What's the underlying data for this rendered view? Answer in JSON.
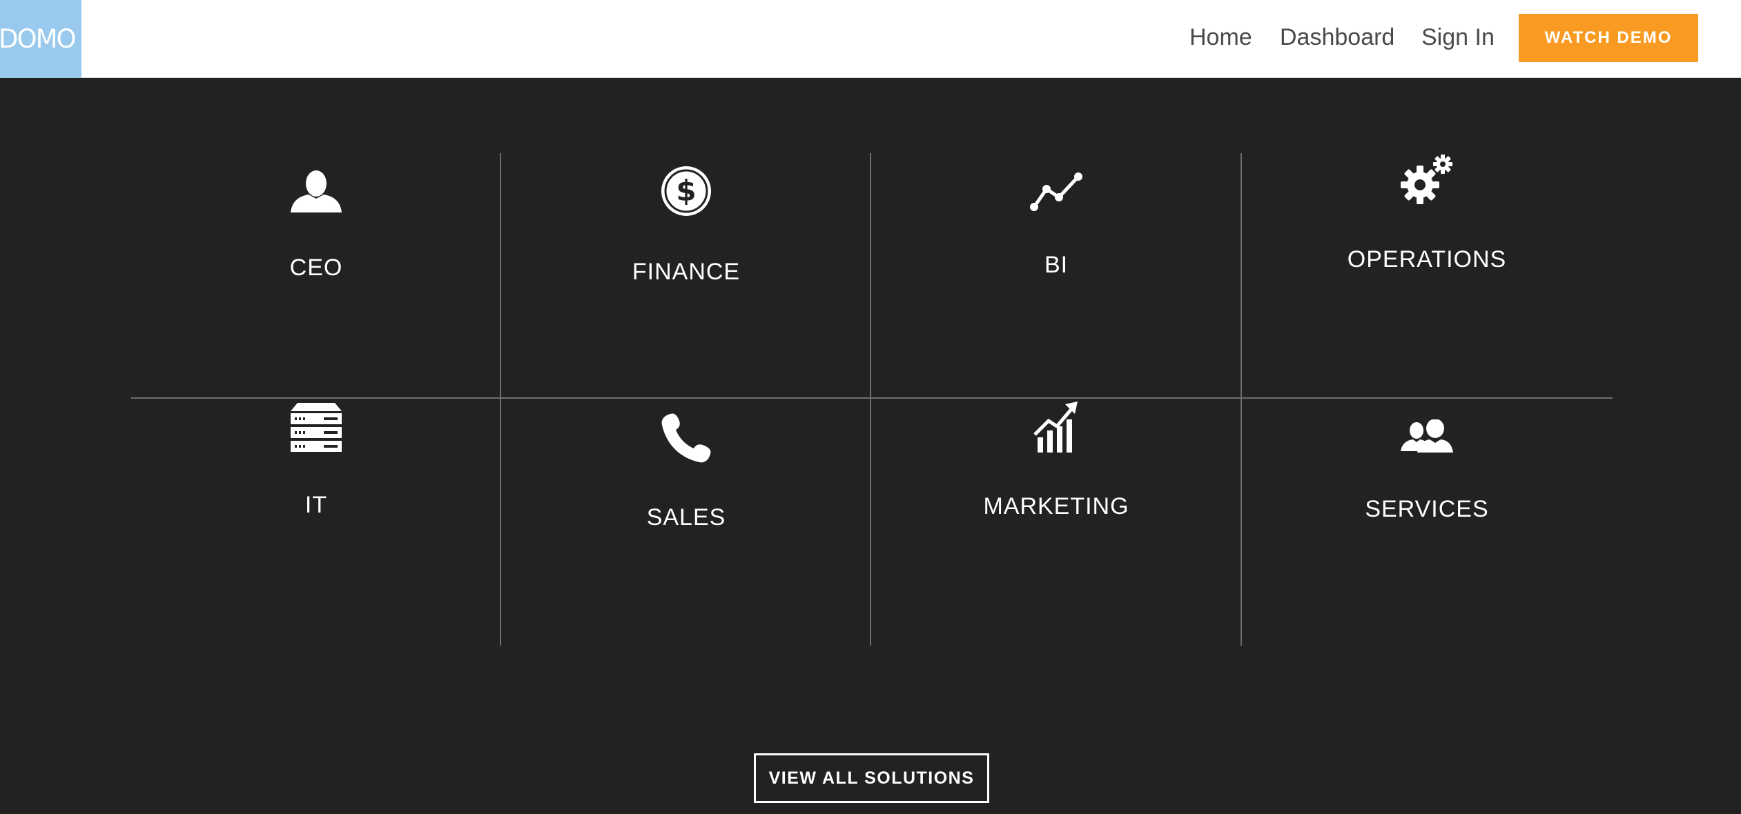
{
  "header": {
    "logo_text": "DOMO",
    "nav": [
      {
        "label": "Home"
      },
      {
        "label": "Dashboard"
      },
      {
        "label": "Sign In"
      }
    ],
    "cta_label": "WATCH DEMO"
  },
  "solutions": [
    {
      "label": "CEO",
      "icon": "user-icon"
    },
    {
      "label": "FINANCE",
      "icon": "dollar-coin-icon"
    },
    {
      "label": "BI",
      "icon": "line-graph-icon"
    },
    {
      "label": "OPERATIONS",
      "icon": "gears-icon"
    },
    {
      "label": "IT",
      "icon": "server-icon"
    },
    {
      "label": "SALES",
      "icon": "phone-icon"
    },
    {
      "label": "MARKETING",
      "icon": "growth-chart-icon"
    },
    {
      "label": "SERVICES",
      "icon": "users-icon"
    }
  ],
  "view_all_label": "VIEW ALL SOLUTIONS",
  "colors": {
    "background": "#222222",
    "header_bg": "#ffffff",
    "logo_bg": "#99c9ec",
    "accent": "#f99b22",
    "divider": "#6e6e6e"
  }
}
